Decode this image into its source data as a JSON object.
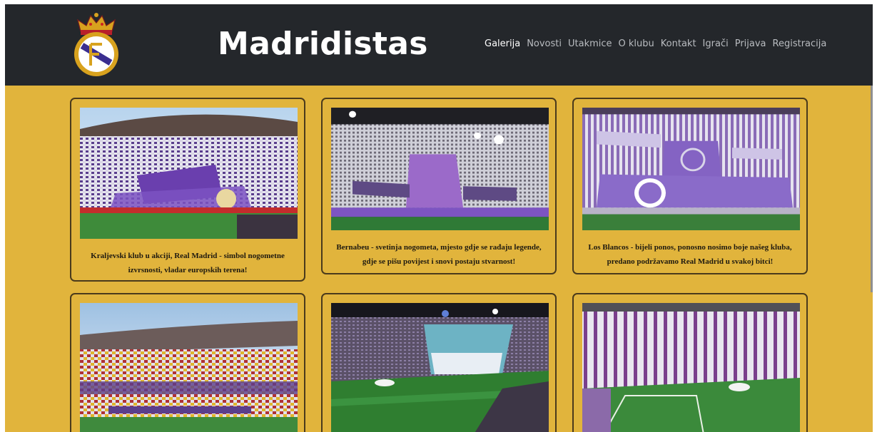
{
  "header": {
    "site_title": "Madridistas",
    "nav": [
      {
        "label": "Galerija",
        "active": true
      },
      {
        "label": "Novosti"
      },
      {
        "label": "Utakmice"
      },
      {
        "label": "O klubu"
      },
      {
        "label": "Kontakt"
      },
      {
        "label": "Igrači"
      },
      {
        "label": "Prijava"
      },
      {
        "label": "Registracija"
      }
    ]
  },
  "gallery": {
    "cards": [
      {
        "caption": "Kraljevski klub u akciji, Real Madrid - simbol nogometne izvrsnosti, vladar europskih terena!"
      },
      {
        "caption": "Bernabeu - svetinja nogometa, mjesto gdje se rađaju legende, gdje se pišu povijest i snovi postaju stvarnost!"
      },
      {
        "caption": "Los Blancos - bijeli ponos, ponosno nosimo boje našeg kluba, predano podržavamo Real Madrid u svakoj bitci!"
      },
      {
        "caption": ""
      },
      {
        "caption": ""
      },
      {
        "caption": ""
      }
    ]
  },
  "colors": {
    "navbar_bg": "#24272b",
    "page_bg": "#e1b43c",
    "card_border": "#4a3a1c",
    "nav_active": "#ffffff",
    "nav_inactive": "#b9bcc0"
  }
}
